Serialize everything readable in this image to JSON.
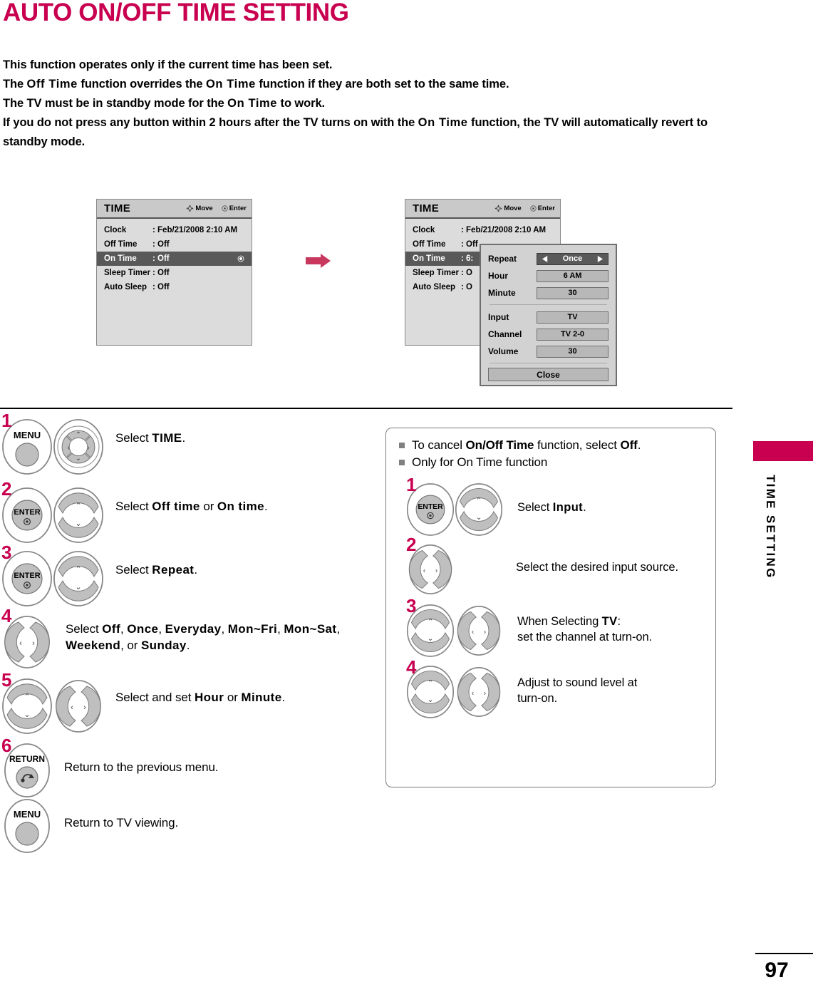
{
  "page": {
    "title": "AUTO ON/OFF TIME SETTING",
    "number": "97",
    "side_tab": "TIME SETTING",
    "accent_color": "#C8004F"
  },
  "intro": {
    "line1": "This function operates only if the current time has been set.",
    "line2_a": "The ",
    "line2_kw1": "Off Time",
    "line2_b": " function overrides the ",
    "line2_kw2": "On Time",
    "line2_c": " function if they are both set to the same time.",
    "line3_a": "The TV must be in standby mode for the ",
    "line3_kw": "On Time",
    "line3_b": " to work.",
    "line4_a": "If you do not press any button within 2 hours after the TV turns on with the ",
    "line4_kw": "On Time",
    "line4_b": " function, the TV will automatically revert to standby mode."
  },
  "osd": {
    "menu1": {
      "title": "TIME",
      "hint_move": "Move",
      "hint_enter": "Enter",
      "rows": [
        {
          "label": "Clock",
          "value": ": Feb/21/2008  2:10 AM",
          "selected": false
        },
        {
          "label": "Off Time",
          "value": ": Off",
          "selected": false
        },
        {
          "label": "On Time",
          "value": ": Off",
          "selected": true
        },
        {
          "label": "Sleep Timer",
          "value": ": Off",
          "selected": false
        },
        {
          "label": "Auto Sleep",
          "value": ": Off",
          "selected": false
        }
      ]
    },
    "menu2": {
      "title": "TIME",
      "hint_move": "Move",
      "hint_enter": "Enter",
      "rows": [
        {
          "label": "Clock",
          "value": ": Feb/21/2008  2:10 AM",
          "selected": false
        },
        {
          "label": "Off Time",
          "value": ": Off",
          "selected": false
        },
        {
          "label": "On Time",
          "value": ": 6:",
          "selected": true
        },
        {
          "label": "Sleep Timer",
          "value": ": O",
          "selected": false
        },
        {
          "label": "Auto Sleep",
          "value": ": O",
          "selected": false
        }
      ]
    },
    "popup": {
      "repeat_label": "Repeat",
      "repeat_value": "Once",
      "hour_label": "Hour",
      "hour_value": "6 AM",
      "minute_label": "Minute",
      "minute_value": "30",
      "input_label": "Input",
      "input_value": "TV",
      "channel_label": "Channel",
      "channel_value": "TV 2-0",
      "volume_label": "Volume",
      "volume_value": "30",
      "close_label": "Close"
    }
  },
  "steps_left": [
    {
      "num": "1",
      "buttons": [
        "menu",
        "dpad4"
      ],
      "text_pre": "Select ",
      "text_kw1": "TIME",
      "text_mid": ".",
      "text_kw2": "",
      "text_post": ""
    },
    {
      "num": "2",
      "buttons": [
        "enter",
        "updown"
      ],
      "text_pre": "Select ",
      "text_kw1": "Off time",
      "text_mid": " or ",
      "text_kw2": "On time",
      "text_post": "."
    },
    {
      "num": "3",
      "buttons": [
        "enter",
        "updown"
      ],
      "text_pre": "Select ",
      "text_kw1": "Repeat",
      "text_mid": ".",
      "text_kw2": "",
      "text_post": ""
    },
    {
      "num": "4",
      "buttons": [
        "leftright"
      ],
      "text_pre": "Select ",
      "text_kw1": "Off",
      "text_mid": ", ",
      "text_kw2": "Once",
      "text_post": ", ",
      "text_kw3": "Everyday",
      "text_post2": ", ",
      "text_kw4": "Mon~Fri",
      "text_post3": ", ",
      "text_kw5": "Mon~Sat",
      "text_post4": ", ",
      "text_kw6": "Weekend",
      "text_post5": ", or ",
      "text_kw7": "Sunday",
      "text_post6": "."
    },
    {
      "num": "5",
      "buttons": [
        "updown",
        "leftright"
      ],
      "text_pre": "Select and set ",
      "text_kw1": "Hour",
      "text_mid": " or ",
      "text_kw2": "Minute",
      "text_post": "."
    },
    {
      "num": "6",
      "buttons": [
        "return"
      ],
      "text_pre": "Return to the previous menu.",
      "text_kw1": "",
      "text_mid": "",
      "text_kw2": "",
      "text_post": ""
    },
    {
      "num": "",
      "buttons": [
        "menu"
      ],
      "text_pre": "Return to TV viewing.",
      "text_kw1": "",
      "text_mid": "",
      "text_kw2": "",
      "text_post": ""
    }
  ],
  "notes": {
    "bullet1_pre": "To cancel ",
    "bullet1_kw1": "On/Off Time",
    "bullet1_mid": " function, select ",
    "bullet1_kw2": "Off",
    "bullet1_post": ".",
    "bullet2": "Only for On Time function"
  },
  "steps_right": [
    {
      "num": "1",
      "buttons": [
        "enter",
        "updown"
      ],
      "text_pre": "Select ",
      "text_kw1": "Input",
      "text_post": "."
    },
    {
      "num": "2",
      "buttons": [
        "leftright"
      ],
      "text_pre": "Select the desired input source.",
      "text_kw1": "",
      "text_post": ""
    },
    {
      "num": "3",
      "buttons": [
        "updown",
        "leftright"
      ],
      "text_pre": "When Selecting ",
      "text_kw1": "TV",
      "text_post": ":",
      "text_line2": "set the channel at turn-on."
    },
    {
      "num": "4",
      "buttons": [
        "updown",
        "leftright"
      ],
      "text_pre": "Adjust to sound level at",
      "text_kw1": "",
      "text_post": "",
      "text_line2": "turn-on."
    }
  ],
  "button_labels": {
    "menu": "MENU",
    "enter": "ENTER",
    "return": "RETURN"
  }
}
